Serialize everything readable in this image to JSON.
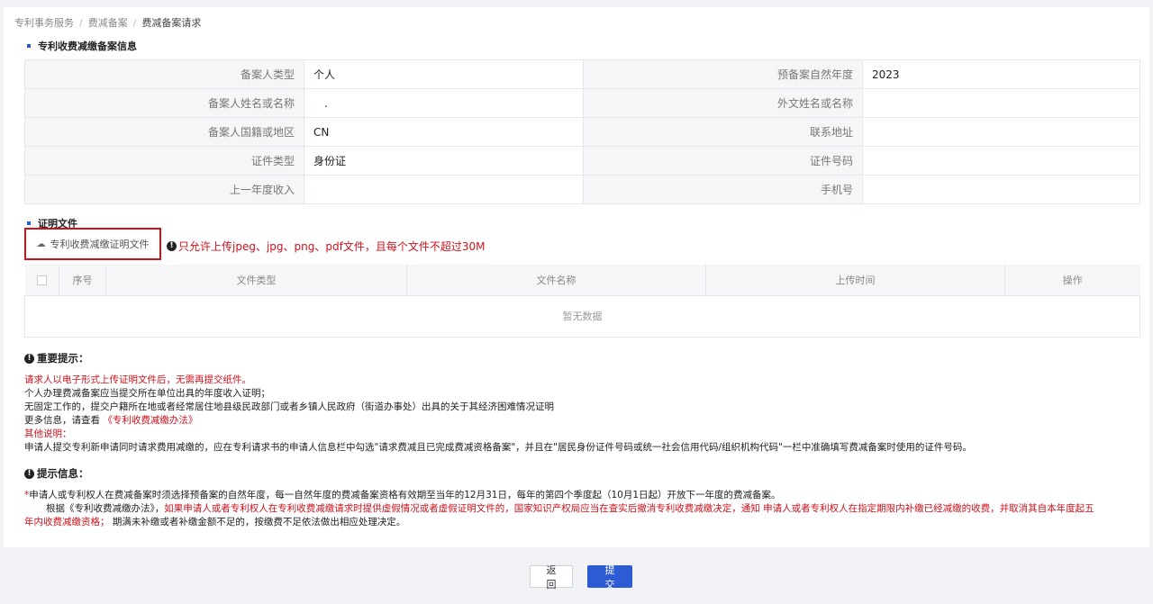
{
  "breadcrumb": [
    "专利事务服务",
    "费减备案",
    "费减备案请求"
  ],
  "sections": {
    "info_title": "专利收费减缴备案信息",
    "proof_title": "证明文件"
  },
  "info_rows": [
    {
      "label1": "备案人类型",
      "value1": "个人",
      "label2": "预备案自然年度",
      "value2": "2023"
    },
    {
      "label1": "备案人姓名或名称",
      "value1": ".",
      "label2": "外文姓名或名称",
      "value2": ""
    },
    {
      "label1": "备案人国籍或地区",
      "value1": "CN",
      "label2": "联系地址",
      "value2": ""
    },
    {
      "label1": "证件类型",
      "value1": "身份证",
      "label2": "证件号码",
      "value2": ""
    },
    {
      "label1": "上一年度收入",
      "value1": "",
      "label2": "手机号",
      "value2": ""
    }
  ],
  "upload": {
    "button_label": "专利收费减缴证明文件",
    "hint": "只允许上传jpeg、jpg、png、pdf文件，且每个文件不超过30M"
  },
  "file_table": {
    "columns": [
      "序号",
      "文件类型",
      "文件名称",
      "上传时间",
      "操作"
    ],
    "empty_text": "暂无数据"
  },
  "important": {
    "title": "重要提示：",
    "line1": "请求人以电子形式上传证明文件后，无需再提交纸件。",
    "line2": "个人办理费减备案应当提交所在单位出具的年度收入证明；",
    "line3": "无固定工作的，提交户籍所在地或者经常居住地县级民政部门或者乡镇人民政府（街道办事处）出具的关于其经济困难情况证明",
    "line4_prefix": "更多信息，请查看",
    "line4_link": "《专利收费减缴办法》",
    "other_title": "其他说明：",
    "other_text": "申请人提交专利新申请同时请求费用减缴的，应在专利请求书的申请人信息栏中勾选\"请求费减且已完成费减资格备案\"，并且在\"居民身份证件号码或统一社会信用代码/组织机构代码\"一栏中准确填写费减备案时使用的证件号码。"
  },
  "tips": {
    "title": "提示信息：",
    "line1_star": "*",
    "line1": "申请人或专利权人在费减备案时须选择预备案的自然年度，每一自然年度的费减备案资格有效期至当年的12月31日，每年的第四个季度起（10月1日起）开放下一年度的费减备案。",
    "line2_prefix": "根据《专利收费减缴办法》，",
    "line2_red": "如果申请人或者专利权人在专利收费减缴请求时提供虚假情况或者虚假证明文件的，国家知识产权局应当在查实后撤消专利收费减缴决定，通知 申请人或者专利权人在指定期限内补缴已经减缴的收费，并取消其自本年度起五",
    "line3_red": "年内收费减缴资格；",
    "line3_rest": "期满未补缴或者补缴金额不足的，按缴费不足依法做出相应处理决定。"
  },
  "buttons": {
    "back": "返 回",
    "submit": "提 交"
  },
  "colors": {
    "accent": "#2d5bd4",
    "warning_red": "#d0111b"
  }
}
